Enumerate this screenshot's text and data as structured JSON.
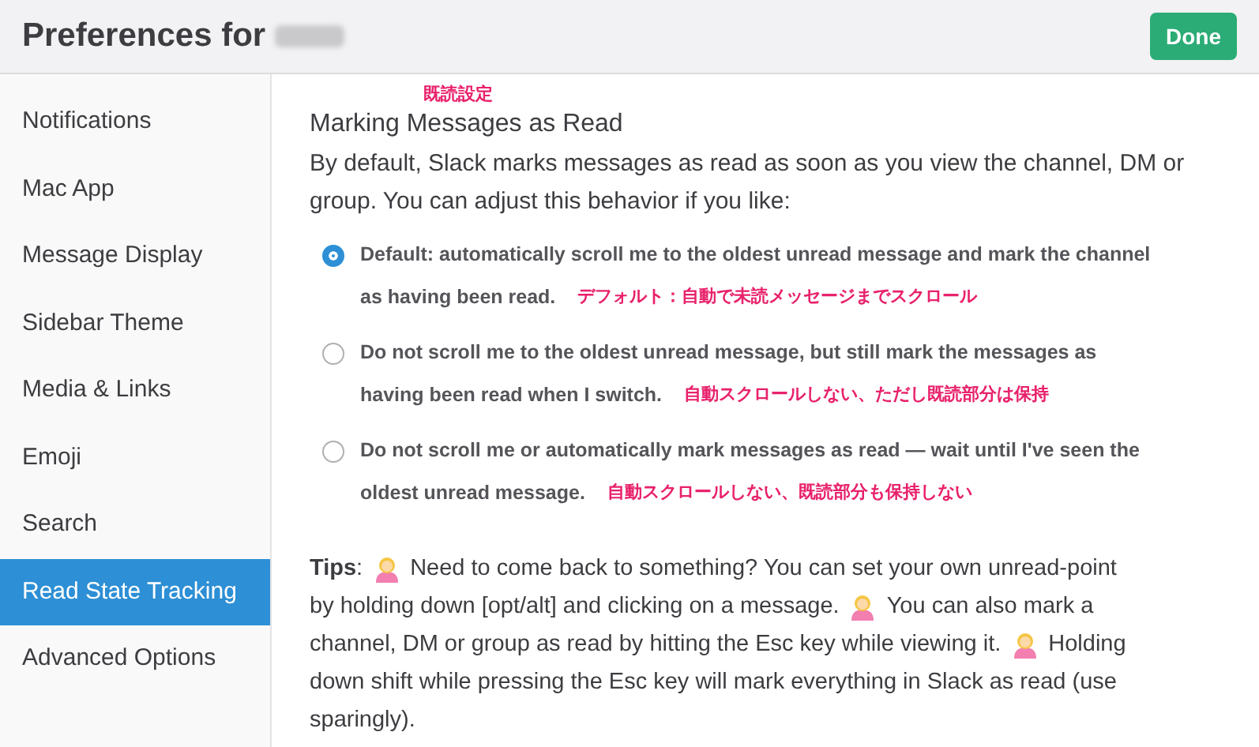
{
  "header": {
    "title": "Preferences for",
    "done_button": "Done"
  },
  "sidebar": {
    "items": [
      {
        "label": "Notifications",
        "selected": false
      },
      {
        "label": "Mac App",
        "selected": false
      },
      {
        "label": "Message Display",
        "selected": false
      },
      {
        "label": "Sidebar Theme",
        "selected": false
      },
      {
        "label": "Media & Links",
        "selected": false
      },
      {
        "label": "Emoji",
        "selected": false
      },
      {
        "label": "Search",
        "selected": false
      },
      {
        "label": "Read State Tracking",
        "selected": true
      },
      {
        "label": "Advanced Options",
        "selected": false
      }
    ]
  },
  "section": {
    "annotation": "既読設定",
    "heading": "Marking Messages as Read",
    "description": "By default, Slack marks messages as read as soon as you view the channel, DM or group. You can adjust this behavior if you like:",
    "options": [
      {
        "label_lines": [
          "Default: automatically scroll me to the oldest unread message and mark the channel",
          "as having been read."
        ],
        "annotation": "デフォルト：自動で未読メッセージまでスクロール",
        "selected": true
      },
      {
        "label_lines": [
          "Do not scroll me to the oldest unread message, but still mark the messages as",
          "having been read when I switch."
        ],
        "annotation": "自動スクロールしない、ただし既読部分は保持",
        "selected": false
      },
      {
        "label_lines": [
          "Do not scroll me or automatically mark messages as read — wait until I've seen the",
          "oldest unread message."
        ],
        "annotation": "自動スクロールしない、既読部分も保持しない",
        "selected": false
      }
    ],
    "tips": {
      "label": "**Tips**:",
      "lines": [
        [
          {
            "kind": "icon"
          },
          {
            "kind": "text",
            "text": "Need to come back to something? You can set your own unread-point"
          }
        ],
        [
          {
            "kind": "text",
            "text": "by holding down [opt/alt] and clicking on a message."
          },
          {
            "kind": "icon"
          },
          {
            "kind": "text",
            "text": "You can also mark a"
          }
        ],
        [
          {
            "kind": "text",
            "text": "channel, DM or group as read by hitting the Esc key while viewing it."
          },
          {
            "kind": "icon"
          },
          {
            "kind": "text",
            "text": "Holding"
          }
        ],
        [
          {
            "kind": "text",
            "text": "down shift while pressing the Esc key will mark everything in Slack as read (use"
          }
        ],
        [
          {
            "kind": "text",
            "text": "sparingly)."
          }
        ]
      ]
    }
  }
}
